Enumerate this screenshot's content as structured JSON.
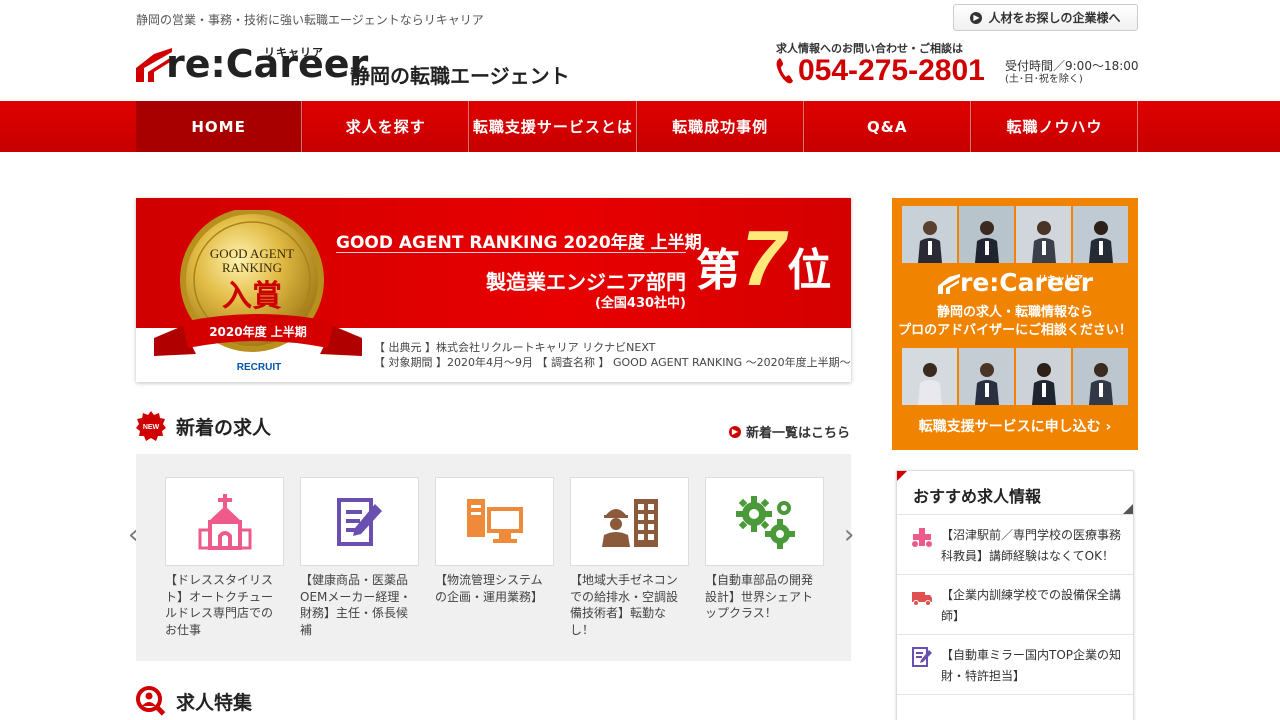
{
  "header": {
    "tagline": "静岡の営業・事務・技術に強い転職エージェントならリキャリア",
    "company_button": "人材をお探しの企業様へ",
    "logo_text": "re:Career",
    "logo_ruby": "リキャリア",
    "logo_sub": "静岡の転職エージェント",
    "contact_label": "求人情報へのお問い合わせ・ご相談は",
    "phone": "054-275-2801",
    "hours": "受付時間／9:00～18:00",
    "hours_note": "(土･日･祝を除く)"
  },
  "nav": {
    "items": [
      "HOME",
      "求人を探す",
      "転職支援サービスとは",
      "転職成功事例",
      "Q&A",
      "転職ノウハウ"
    ]
  },
  "banner": {
    "medal_line1": "GOOD AGENT",
    "medal_line2": "RANKING",
    "medal_award": "入賞",
    "medal_ribbon": "2020年度 上半期",
    "medal_brand": "RECRUIT",
    "title": "GOOD AGENT RANKING 2020年度 上半期",
    "dept": "製造業エンジニア部門",
    "count": "(全国430社中)",
    "rank_pre": "第",
    "rank_num": "7",
    "rank_post": "位",
    "source1": "【 出典元 】株式会社リクルートキャリア リクナビNEXT",
    "source2": "【 対象期間 】2020年4月～9月 【 調査名称 】 GOOD AGENT RANKING ～2020年度上半期～"
  },
  "new_jobs": {
    "badge": "NEW",
    "title": "新着の求人",
    "more": "新着一覧はこちら",
    "cards": [
      {
        "icon": "church-icon",
        "text": "【ドレススタイリスト】オートクチュールドレス専門店でのお仕事"
      },
      {
        "icon": "document-edit-icon",
        "text": "【健康商品・医薬品OEMメーカー経理・財務】主任・係長候補"
      },
      {
        "icon": "computer-system-icon",
        "text": "【物流管理システムの企画・運用業務】"
      },
      {
        "icon": "worker-building-icon",
        "text": "【地域大手ゼネコンでの給排水・空調設備技術者】転勤なし！"
      },
      {
        "icon": "gears-icon",
        "text": "【自動車部品の開発設計】世界シェアトップクラス！"
      }
    ]
  },
  "feature": {
    "title": "求人特集"
  },
  "side_banner": {
    "logo_text": "re:Career",
    "logo_ruby": "リキャリア",
    "line1": "静岡の求人・転職情報なら",
    "line2": "プロのアドバイザーにご相談ください！",
    "cta": "転職支援サービスに申し込む"
  },
  "recommended": {
    "title": "おすすめ求人情報",
    "items": [
      {
        "icon": "medical-icon",
        "text": "【沼津駅前／専門学校の医療事務科教員】講師経験はなくてOK！"
      },
      {
        "icon": "truck-icon",
        "text": "【企業内訓練学校での設備保全講師】"
      },
      {
        "icon": "document-edit-icon",
        "text": "【自動車ミラー国内TOP企業の知財・特許担当】"
      }
    ]
  },
  "colors": {
    "brand_red": "#d10000",
    "nav_active": "#a80000",
    "orange": "#f08300",
    "gold": "#d4a520"
  }
}
